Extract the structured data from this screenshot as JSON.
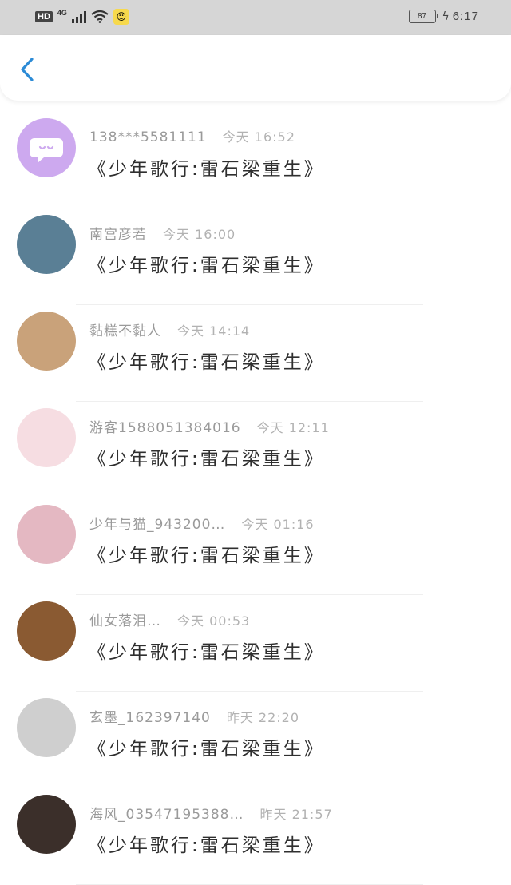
{
  "status_bar": {
    "hd": "HD",
    "network": "4G",
    "battery": "87",
    "time": "6:17"
  },
  "header": {
    "back_icon": "chevron-left-icon"
  },
  "messages": [
    {
      "name": "138***5581111",
      "time": "今天 16:52",
      "title": "《少年歌行:雷石梁重生》",
      "avatar_color": "#cda9ef"
    },
    {
      "name": "南宫彦若",
      "time": "今天 16:00",
      "title": "《少年歌行:雷石梁重生》",
      "avatar_color": "#5a7f95"
    },
    {
      "name": "黏糕不黏人",
      "time": "今天 14:14",
      "title": "《少年歌行:雷石梁重生》",
      "avatar_color": "#c9a27a"
    },
    {
      "name": "游客1588051384016",
      "time": "今天 12:11",
      "title": "《少年歌行:雷石梁重生》",
      "avatar_color": "#f6dde2"
    },
    {
      "name": "少年与猫_943200…",
      "time": "今天 01:16",
      "title": "《少年歌行:雷石梁重生》",
      "avatar_color": "#e4b8c2"
    },
    {
      "name": "仙女落泪…",
      "time": "今天 00:53",
      "title": "《少年歌行:雷石梁重生》",
      "avatar_color": "#8a5a32"
    },
    {
      "name": "玄墨_162397140",
      "time": "昨天 22:20",
      "title": "《少年歌行:雷石梁重生》",
      "avatar_color": "#cfcfcf"
    },
    {
      "name": "海风_03547195388…",
      "time": "昨天 21:57",
      "title": "《少年歌行:雷石梁重生》",
      "avatar_color": "#3b2f2a"
    }
  ]
}
